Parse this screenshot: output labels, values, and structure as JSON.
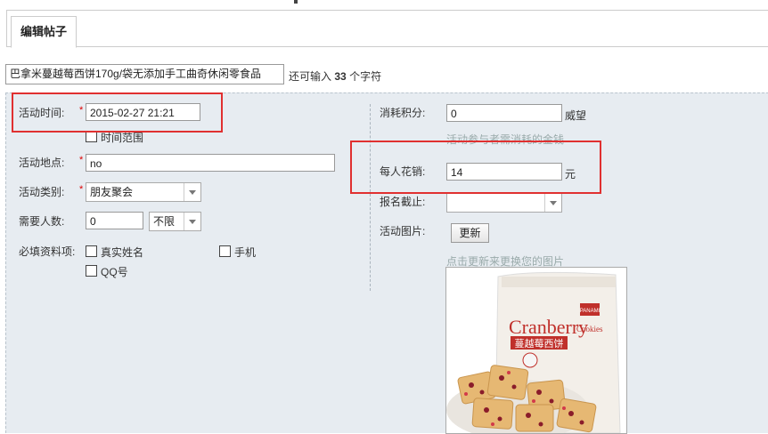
{
  "tab": {
    "label": "编辑帖子"
  },
  "title_field": {
    "value": "巴拿米蔓越莓西饼170g/袋无添加手工曲奇休闲零食品"
  },
  "remain": {
    "prefix": "还可输入",
    "count": "33",
    "suffix": "个字符"
  },
  "form": {
    "time_label": "活动时间:",
    "time_value": "2015-02-27 21:21",
    "time_range_label": "时间范围",
    "place_label": "活动地点:",
    "place_value": "no",
    "type_label": "活动类别:",
    "type_value": "朋友聚会",
    "people_label": "需要人数:",
    "people_value": "0",
    "people_limit": "不限",
    "required_label": "必填资料项:",
    "opt_realname": "真实姓名",
    "opt_phone": "手机",
    "opt_qq": "QQ号",
    "points_label": "消耗积分:",
    "points_value": "0",
    "points_unit": "威望",
    "points_hint": "活动参与者需消耗的金钱",
    "cost_label": "每人花销:",
    "cost_value": "14",
    "cost_unit": "元",
    "deadline_label": "报名截止:",
    "deadline_value": "",
    "image_label": "活动图片:",
    "update_button": "更新",
    "image_hint": "点击更新来更换您的图片",
    "required_mark": "*"
  },
  "product_image": {
    "brand": "PANAMI",
    "title_en": "Cranberry",
    "title_en2": "Cookies",
    "title_cn": "蔓越莓西饼"
  },
  "colors": {
    "highlight": "#e03030",
    "panel": "#e7ecf1"
  }
}
